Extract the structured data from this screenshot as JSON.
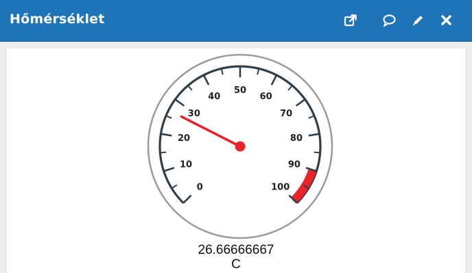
{
  "header": {
    "title": "Hőmérséklet",
    "background": "#1f74b8",
    "icons": [
      "open-external-icon",
      "comment-icon",
      "edit-icon",
      "close-icon"
    ]
  },
  "gauge": {
    "min": 0,
    "max": 100,
    "value": 26.66666667,
    "value_text": "26.66666667",
    "unit": "C",
    "tick_labels": [
      "0",
      "10",
      "20",
      "30",
      "40",
      "50",
      "60",
      "70",
      "80",
      "90",
      "100"
    ],
    "danger_band": {
      "from": 90,
      "to": 100,
      "color": "#e8232a"
    },
    "needle_color": "#e8232a",
    "arc_color": "#2f3e4a"
  }
}
